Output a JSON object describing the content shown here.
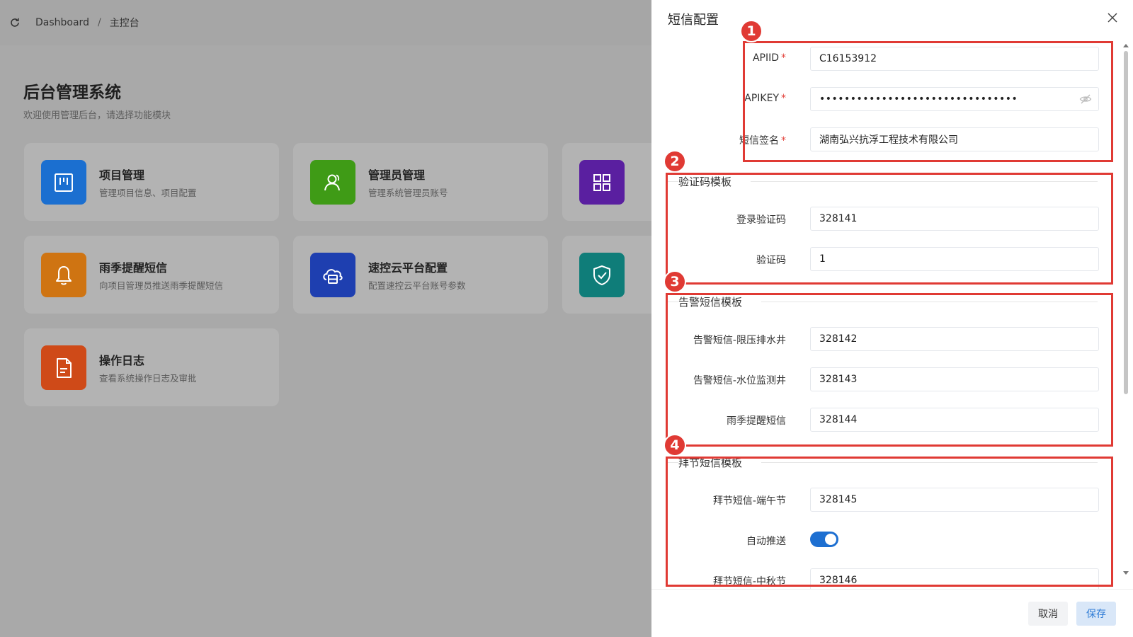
{
  "breadcrumb": {
    "items": [
      "Dashboard",
      "主控台"
    ],
    "separator": "/"
  },
  "page": {
    "title": "后台管理系统",
    "subtitle": "欢迎使用管理后台，请选择功能模块"
  },
  "cards": [
    {
      "title": "项目管理",
      "desc": "管理项目信息、项目配置",
      "icon": "kanban-icon",
      "color": "#1b6fd0"
    },
    {
      "title": "管理员管理",
      "desc": "管理系统管理员账号",
      "icon": "user-icon",
      "color": "#3f9b16"
    },
    {
      "title": "",
      "desc": "",
      "icon": "grid-icon",
      "color": "#5a1fa0"
    },
    {
      "title": "雨季提醒短信",
      "desc": "向项目管理员推送雨季提醒短信",
      "icon": "bell-icon",
      "color": "#cf7412"
    },
    {
      "title": "速控云平台配置",
      "desc": "配置速控云平台账号参数",
      "icon": "cloud-server-icon",
      "color": "#1e3fb0"
    },
    {
      "title": "",
      "desc": "",
      "icon": "shield-check-icon",
      "color": "#0f7d79"
    },
    {
      "title": "操作日志",
      "desc": "查看系统操作日志及审批",
      "icon": "document-icon",
      "color": "#cf4a18"
    }
  ],
  "drawer": {
    "title": "短信配置",
    "fields": {
      "apiid": {
        "label": "APIID",
        "value": "C16153912"
      },
      "apikey": {
        "label": "APIKEY",
        "value": "••••••••••••••••••••••••••••••••"
      },
      "signature": {
        "label": "短信签名",
        "value": "湖南弘兴抗浮工程技术有限公司"
      }
    },
    "sections": {
      "verify": {
        "title": "验证码模板",
        "fields": [
          {
            "label": "登录验证码",
            "value": "328141"
          },
          {
            "label": "验证码",
            "value": "1"
          }
        ]
      },
      "alarm": {
        "title": "告警短信模板",
        "fields": [
          {
            "label": "告警短信-限压排水井",
            "value": "328142"
          },
          {
            "label": "告警短信-水位监测井",
            "value": "328143"
          },
          {
            "label": "雨季提醒短信",
            "value": "328144"
          }
        ]
      },
      "holiday": {
        "title": "拜节短信模板",
        "fields": [
          {
            "label": "拜节短信-端午节",
            "value": "328145"
          }
        ],
        "auto_push_label": "自动推送",
        "auto_push_on": true,
        "cut_row_label": "拜节短信-中秋节",
        "cut_row_value": "328146"
      }
    },
    "buttons": {
      "cancel": "取消",
      "save": "保存"
    }
  },
  "annotations": [
    "1",
    "2",
    "3",
    "4"
  ],
  "colors": {
    "annotation": "#e03a34",
    "primary": "#1d6fd1"
  }
}
